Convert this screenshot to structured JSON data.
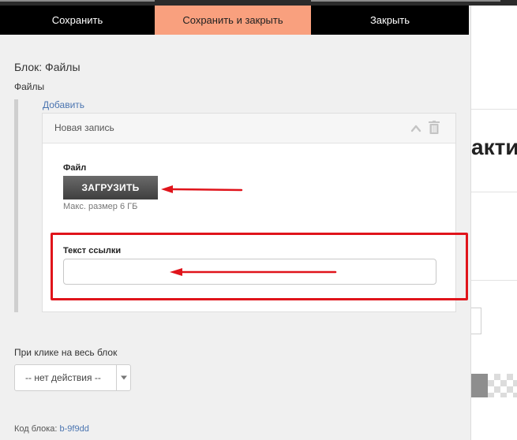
{
  "toolbar": {
    "save": "Сохранить",
    "save_close": "Сохранить и закрыть",
    "close": "Закрыть"
  },
  "block": {
    "title": "Блок: Файлы",
    "section": "Файлы",
    "add_link": "Добавить"
  },
  "entry": {
    "title": "Новая запись",
    "file_label": "Файл",
    "upload_button": "ЗАГРУЗИТЬ",
    "max_size": "Макс. размер 6 ГБ",
    "link_text_label": "Текст ссылки",
    "link_text_value": ""
  },
  "click_action": {
    "label": "При клике на весь блок",
    "selected": "-- нет действия --"
  },
  "code": {
    "label": "Код блока:",
    "value": "b-9f9dd"
  },
  "background_page": {
    "heading_fragment": "акти"
  },
  "colors": {
    "toolbar_bg": "#000000",
    "toolbar_active": "#f9a07e",
    "link": "#4a74b0",
    "annotation": "#e0141b"
  }
}
